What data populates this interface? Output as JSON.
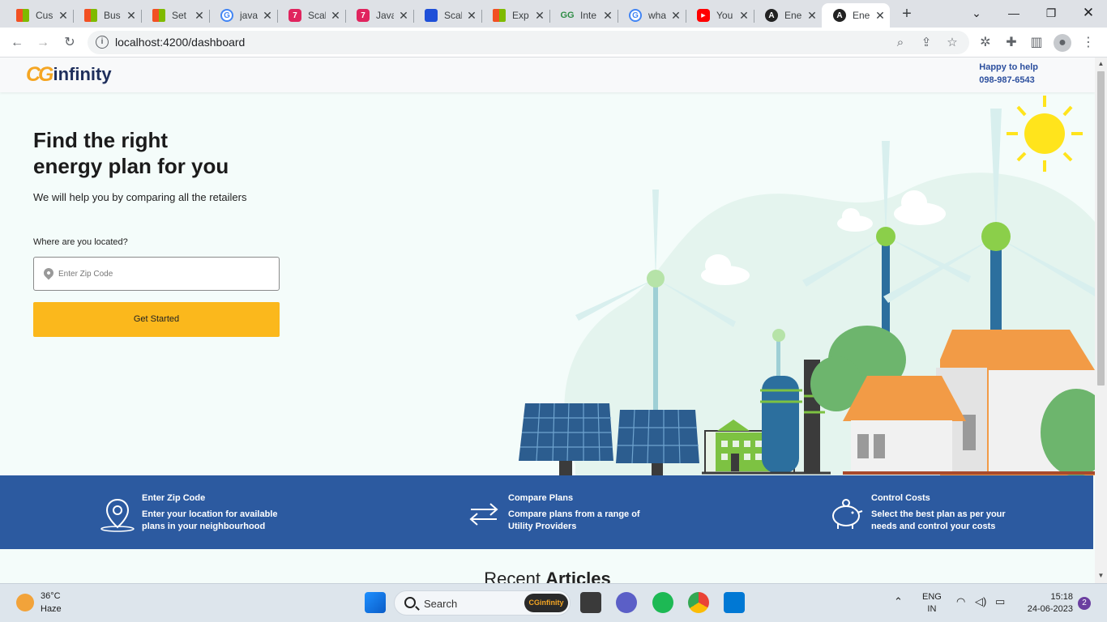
{
  "browser": {
    "tabs": [
      {
        "title": "Cus",
        "icon": "microsoft-icon"
      },
      {
        "title": "Bus",
        "icon": "microsoft-icon"
      },
      {
        "title": "Set",
        "icon": "microsoft-icon"
      },
      {
        "title": "java",
        "icon": "google-icon"
      },
      {
        "title": "Scal",
        "icon": "scaler-icon"
      },
      {
        "title": "Java",
        "icon": "scaler-icon"
      },
      {
        "title": "Scal",
        "icon": "scaler-blue-icon"
      },
      {
        "title": "Exp",
        "icon": "microsoft-icon"
      },
      {
        "title": "Inte",
        "icon": "geeksforgeeks-icon"
      },
      {
        "title": "wha",
        "icon": "google-icon"
      },
      {
        "title": "You",
        "icon": "youtube-icon"
      },
      {
        "title": "Ene",
        "icon": "angular-icon"
      },
      {
        "title": "Ene",
        "icon": "angular-icon",
        "active": true
      }
    ],
    "url": "localhost:4200/dashboard"
  },
  "site": {
    "logo_mark": "CG",
    "logo_word": "infinity",
    "help_label": "Happy to help",
    "help_phone": "098-987-6543"
  },
  "hero": {
    "title_line1": "Find the right",
    "title_line2": "energy plan for you",
    "subtitle": "We will help you by comparing all the retailers",
    "location_label": "Where are you located?",
    "zip_placeholder": "Enter Zip Code",
    "cta_label": "Get Started"
  },
  "features": [
    {
      "title": "Enter Zip Code",
      "desc": "Enter your location for available plans in your neighbourhood",
      "icon": "location-pin-icon"
    },
    {
      "title": "Compare Plans",
      "desc": "Compare plans from a range of Utility Providers",
      "icon": "compare-arrows-icon"
    },
    {
      "title": "Control Costs",
      "desc": "Select the best plan as per your needs and control your costs",
      "icon": "piggy-bank-icon"
    }
  ],
  "recent": {
    "prefix": "Recent",
    "bold": "Articles"
  },
  "taskbar": {
    "temp": "36°C",
    "weather": "Haze",
    "search_placeholder": "Search",
    "search_badge": "CGinfinity",
    "lang_line1": "ENG",
    "lang_line2": "IN",
    "time": "15:18",
    "date": "24-06-2023",
    "notifications": "2"
  },
  "colors": {
    "brand_blue": "#2c5aa0",
    "accent_yellow": "#fbb81c",
    "logo_orange": "#f5a623"
  }
}
